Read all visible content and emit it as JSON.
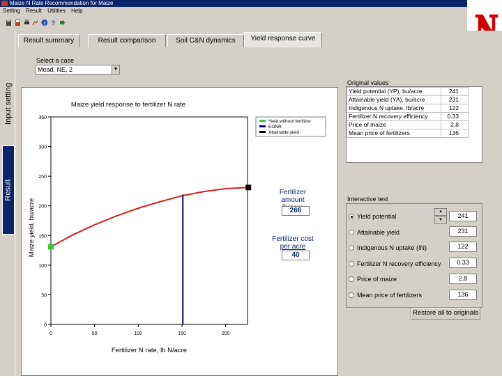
{
  "window": {
    "title": "Maize N Rate Recommendation for Maize"
  },
  "menu": [
    "Setting",
    "Result",
    "Utilities",
    "Help"
  ],
  "vertical_tabs": {
    "input": "Input setting",
    "result": "Result"
  },
  "tabs": [
    "Result summary",
    "Result comparison",
    "Soil C&N dynamics",
    "Yield response curve"
  ],
  "case": {
    "label": "Select a case",
    "value": "Mead, NE, 2"
  },
  "side": {
    "fert_amount_label1": "Fertilizer amount",
    "fert_amount_label2": "lb/acre",
    "fert_amount_value": "266",
    "fert_cost_label1": "Fertilizer cost",
    "fert_cost_label2": "per acre",
    "fert_cost_value": "40"
  },
  "original": {
    "title": "Original values",
    "rows": [
      {
        "label": "Yield potential (YP), bu/acre",
        "value": "241"
      },
      {
        "label": "Attainable yield (YA), bu/acre",
        "value": "231"
      },
      {
        "label": "Indigenous N uptake, lb/acre",
        "value": "122"
      },
      {
        "label": "Fertilizer N recovery efficiency",
        "value": "0.33"
      },
      {
        "label": "Price of maize",
        "value": "2.8"
      },
      {
        "label": "Mean price of fertilizers",
        "value": "136"
      }
    ]
  },
  "interactive": {
    "title": "Interactive test",
    "rows": [
      {
        "label": "Yield potential",
        "value": "241",
        "checked": true
      },
      {
        "label": "Attainable yield",
        "value": "231",
        "checked": false
      },
      {
        "label": "Indigenous N uptake (IN)",
        "value": "122",
        "checked": false
      },
      {
        "label": "Fertilizer N recovery efficiency",
        "value": "0.33",
        "checked": false
      },
      {
        "label": "Price of maize",
        "value": "2.8",
        "checked": false
      },
      {
        "label": "Mean price of fertilizers",
        "value": "136",
        "checked": false
      }
    ],
    "restore_label": "Restore all to originals"
  },
  "chart_data": {
    "type": "line",
    "title": "Maize yield response to fertilizer N rate",
    "xlabel": "Fertilizer N rate, lb N/acre",
    "ylabel": "Maize yield, bu/acre",
    "xlim": [
      0,
      225
    ],
    "ylim": [
      0,
      350
    ],
    "xticks": [
      0,
      50,
      100,
      150,
      200
    ],
    "yticks": [
      0,
      50,
      100,
      150,
      200,
      250,
      300,
      350
    ],
    "series": [
      {
        "name": "Yield without fertilizer",
        "color": "#d42020",
        "x": [
          0,
          25,
          50,
          75,
          100,
          125,
          150,
          175,
          200,
          225
        ],
        "y": [
          131,
          151,
          168,
          183,
          196,
          207,
          217,
          224,
          229,
          231
        ]
      }
    ],
    "markers": [
      {
        "name": "Yield without fertilizer",
        "x": 0,
        "y": 131,
        "color": "#3c3",
        "shape": "square"
      },
      {
        "name": "Attainable yield",
        "x": 226,
        "y": 231,
        "color": "#000",
        "shape": "square"
      }
    ],
    "vline": {
      "name": "EONR",
      "x": 151,
      "y": 219,
      "color": "#000080"
    },
    "legend": [
      {
        "label": "Yield without fertilizer",
        "color": "#3c3"
      },
      {
        "label": "EONR",
        "color": "#000080"
      },
      {
        "label": "Attainable yield",
        "color": "#000"
      }
    ],
    "legend_position": "top-right",
    "grid": false
  }
}
